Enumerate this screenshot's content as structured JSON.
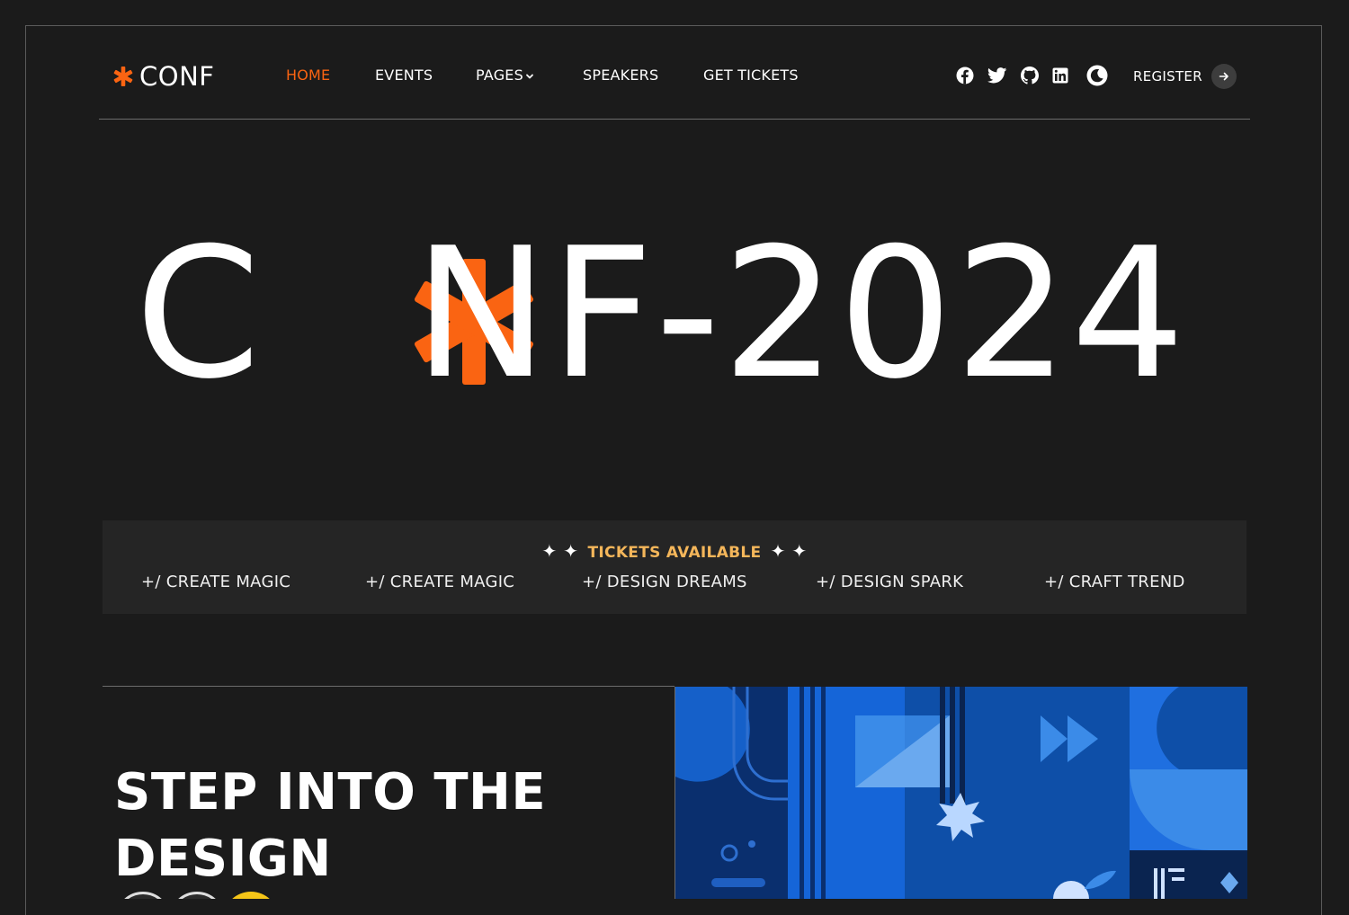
{
  "brand": {
    "logo_text": "CONF",
    "accent": "#fa6412",
    "ticket_color": "#f4b65a"
  },
  "nav": {
    "items": [
      {
        "label": "HOME",
        "active": true
      },
      {
        "label": "EVENTS",
        "active": false
      },
      {
        "label": "PAGES",
        "active": false,
        "has_dropdown": true
      },
      {
        "label": "SPEAKERS",
        "active": false
      },
      {
        "label": "GET TICKETS",
        "active": false
      }
    ]
  },
  "socials": [
    "facebook-icon",
    "twitter-icon",
    "github-icon",
    "linkedin-icon",
    "dark-mode-toggle-icon"
  ],
  "register": {
    "label": "REGISTER",
    "icon": "arrow-right-icon"
  },
  "hero": {
    "part1": "C",
    "part2": "NF-2024"
  },
  "tickets": {
    "title": "TICKETS AVAILABLE",
    "ticker": [
      "+/ CREATE MAGIC",
      "+/ CREATE MAGIC",
      "+/ DESIGN DREAMS",
      "+/ DESIGN SPARK",
      "+/ CRAFT TREND"
    ]
  },
  "section": {
    "heading": "STEP INTO THE DESIGN"
  }
}
